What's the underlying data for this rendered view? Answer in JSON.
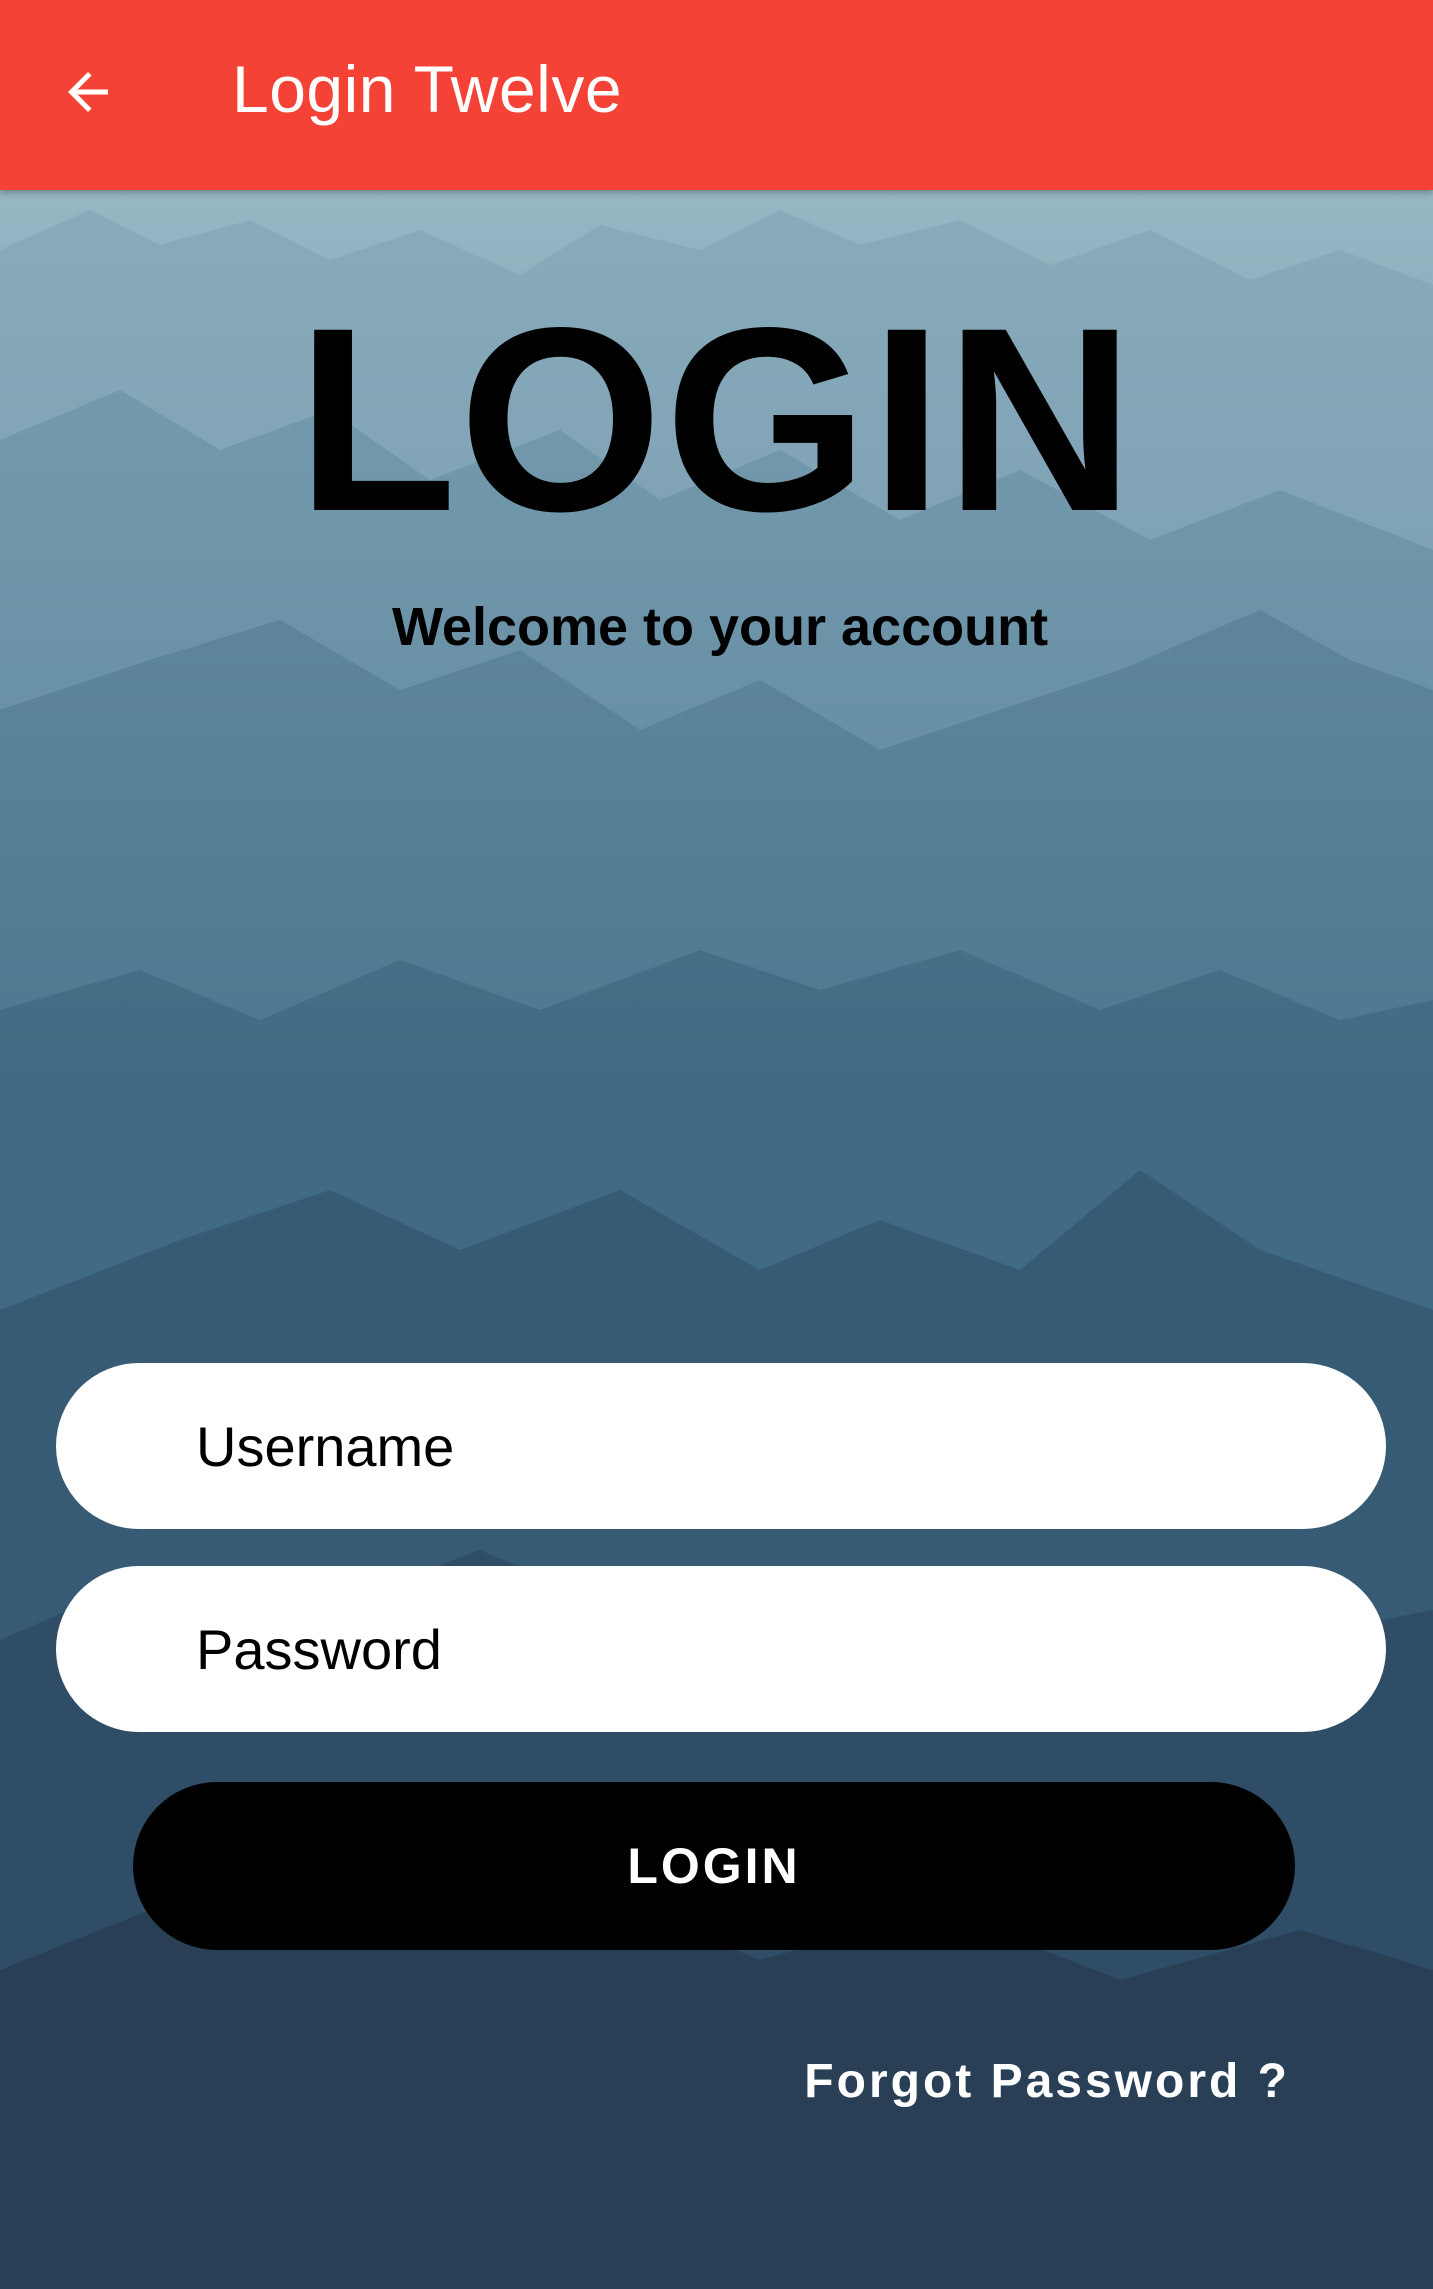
{
  "app_bar": {
    "title": "Login Twelve",
    "back_icon": "arrow-left-icon",
    "color": "#f44336"
  },
  "main": {
    "headline": "LOGIN",
    "subheadline": "Welcome to your account",
    "username": {
      "placeholder": "Username",
      "value": ""
    },
    "password": {
      "placeholder": "Password",
      "value": ""
    },
    "login_button_label": "LOGIN",
    "forgot_password_label": "Forgot Password ?"
  },
  "colors": {
    "button": "#000000",
    "field": "#ffffff",
    "background": "#3f6580"
  }
}
